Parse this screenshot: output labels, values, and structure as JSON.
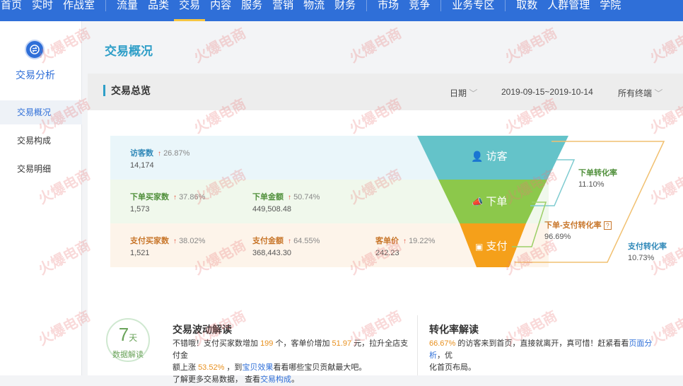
{
  "topnav": {
    "left_items": [
      "首页",
      "实时",
      "作战室"
    ],
    "main_items": [
      "流量",
      "品类",
      "交易",
      "内容",
      "服务",
      "营销",
      "物流",
      "财务"
    ],
    "market_items": [
      "市场",
      "竞争"
    ],
    "zone_items": [
      "业务专区"
    ],
    "right_items": [
      "取数",
      "人群管理",
      "学院"
    ],
    "active": "交易"
  },
  "sidebar": {
    "title": "交易分析",
    "items": [
      "交易概况",
      "交易构成",
      "交易明细"
    ],
    "active": "交易概况"
  },
  "page": {
    "title": "交易概况",
    "section_title": "交易总览",
    "date_label": "日期",
    "date_range": "2019-09-15~2019-10-14",
    "terminal": "所有终端"
  },
  "metrics": {
    "visitors": {
      "label": "访客数",
      "change": "26.87%",
      "value": "14,174"
    },
    "order_buyers": {
      "label": "下单买家数",
      "change": "37.86%",
      "value": "1,573"
    },
    "order_amount": {
      "label": "下单金额",
      "change": "50.74%",
      "value": "449,508.48"
    },
    "pay_buyers": {
      "label": "支付买家数",
      "change": "38.02%",
      "value": "1,521"
    },
    "pay_amount": {
      "label": "支付金额",
      "change": "64.55%",
      "value": "368,443.30"
    },
    "unit_price": {
      "label": "客单价",
      "change": "19.22%",
      "value": "242.23"
    }
  },
  "funnel": {
    "stage1": "访客",
    "stage2": "下单",
    "stage3": "支付",
    "colors": {
      "stage1": "#64c3c9",
      "stage2": "#8cc84b",
      "stage3": "#f5a01a"
    }
  },
  "conversions": {
    "order_rate": {
      "label": "下单转化率",
      "value": "11.10%"
    },
    "order_pay_rate": {
      "label": "下单-支付转化率",
      "value": "96.69%"
    },
    "pay_rate": {
      "label": "支付转化率",
      "value": "10.73%"
    }
  },
  "bottom": {
    "badge_num": "7",
    "badge_unit": "天",
    "badge_text": "数据解读",
    "wave_title": "交易波动解读",
    "wave_p1": "不错哦！支付买家数增加",
    "wave_n1": "199",
    "wave_p2": "个，客单价增加",
    "wave_n2": "51.97",
    "wave_p3": "元，拉升全店支付金",
    "wave_p4": "额上涨",
    "wave_n3": "53.52%",
    "wave_p5": "，到",
    "wave_link1": "宝贝效果",
    "wave_p6": "看看哪些宝贝贡献最大吧。",
    "wave_p7": "了解更多交易数据，",
    "wave_p8": "查看",
    "wave_link2": "交易构成",
    "wave_p9": "。",
    "conv_title": "转化率解读",
    "conv_n1": "66.67%",
    "conv_p1": "的访客来到首页，直接就离开，真可惜！赶紧看看",
    "conv_link": "页面分析",
    "conv_p2": "，优",
    "conv_p3": "化首页布局。"
  },
  "watermark": "火爆电商"
}
